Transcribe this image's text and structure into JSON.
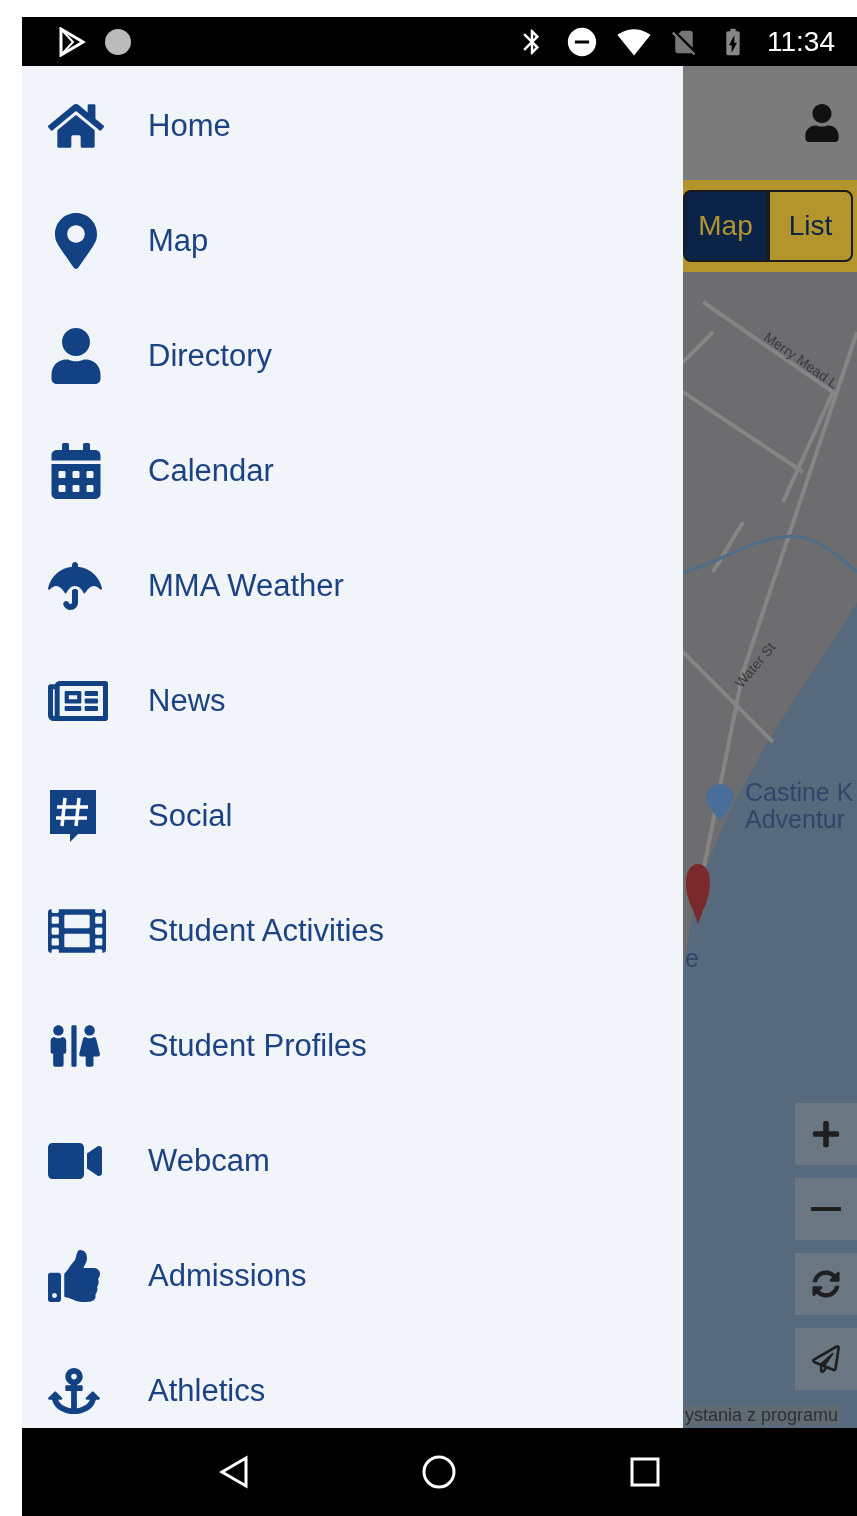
{
  "status_bar": {
    "time": "11:34"
  },
  "drawer": {
    "items": [
      {
        "label": "Home"
      },
      {
        "label": "Map"
      },
      {
        "label": "Directory"
      },
      {
        "label": "Calendar"
      },
      {
        "label": "MMA Weather"
      },
      {
        "label": "News"
      },
      {
        "label": "Social"
      },
      {
        "label": "Student Activities"
      },
      {
        "label": "Student Profiles"
      },
      {
        "label": "Webcam"
      },
      {
        "label": "Admissions"
      },
      {
        "label": "Athletics"
      }
    ]
  },
  "map_screen": {
    "segments": [
      {
        "label": "Map",
        "selected": true
      },
      {
        "label": "List",
        "selected": false
      }
    ],
    "map_labels": [
      {
        "kind": "street",
        "text": "Merry Mead L"
      },
      {
        "kind": "street",
        "text": "Water St"
      },
      {
        "kind": "place",
        "text": "Castine K"
      },
      {
        "kind": "place",
        "text": "Adventur"
      },
      {
        "kind": "place",
        "text": "e"
      }
    ],
    "attribution": "ystania z programu"
  }
}
